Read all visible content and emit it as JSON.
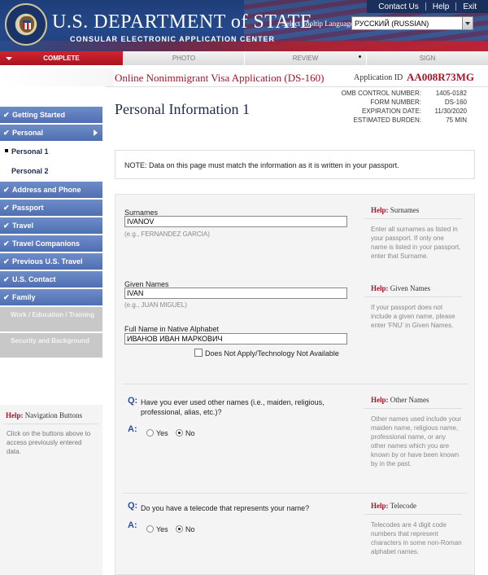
{
  "header": {
    "dept_title": "U.S. DEPARTMENT of STATE",
    "dept_subtitle": "CONSULAR ELECTRONIC APPLICATION CENTER",
    "top_links": [
      "Contact Us",
      "Help",
      "Exit"
    ],
    "tooltip_language_label": "Select Tooltip Language",
    "tooltip_language_value": "РУССКИЙ (RUSSIAN)"
  },
  "progress": {
    "steps": [
      "COMPLETE",
      "PHOTO",
      "REVIEW",
      "SIGN"
    ],
    "active_index": 0
  },
  "app": {
    "title": "Online Nonimmigrant Visa Application (DS-160)",
    "id_label": "Application ID",
    "id_value": "AA008R73MG"
  },
  "omb": [
    {
      "label": "OMB CONTROL NUMBER:",
      "value": "1405-0182"
    },
    {
      "label": "FORM NUMBER:",
      "value": "DS-160"
    },
    {
      "label": "EXPIRATION DATE:",
      "value": "11/30/2020"
    },
    {
      "label": "ESTIMATED BURDEN:",
      "value": "75 MIN"
    }
  ],
  "page_title": "Personal Information 1",
  "note": "NOTE: Data on this page must match the information as it is written in your passport.",
  "sidebar": {
    "items": [
      {
        "label": "Getting Started",
        "type": "nav"
      },
      {
        "label": "Personal",
        "type": "nav"
      },
      {
        "label": "Personal 1",
        "type": "sub"
      },
      {
        "label": "Personal 2",
        "type": "sub"
      },
      {
        "label": "Address and Phone",
        "type": "nav"
      },
      {
        "label": "Passport",
        "type": "nav"
      },
      {
        "label": "Travel",
        "type": "nav"
      },
      {
        "label": "Travel Companions",
        "type": "nav"
      },
      {
        "label": "Previous U.S. Travel",
        "type": "nav"
      },
      {
        "label": "U.S. Contact",
        "type": "nav"
      },
      {
        "label": "Family",
        "type": "nav"
      },
      {
        "label": "Work / Education / Training",
        "type": "disabled"
      },
      {
        "label": "Security and Background",
        "type": "disabled"
      }
    ],
    "check_glyph": "✔",
    "help": {
      "prefix": "Help:",
      "title": "Navigation Buttons",
      "text": "Click on the buttons above to access previously entered data."
    }
  },
  "form": {
    "surnames": {
      "label": "Surnames",
      "value": "IVANOV",
      "hint": "(e.g., FERNANDEZ GARCIA)"
    },
    "given_names": {
      "label": "Given Names",
      "value": "IVAN",
      "hint": "(e.g., JUAN MIGUEL)"
    },
    "native_name": {
      "label": "Full Name in Native Alphabet",
      "value": "ИВАНОВ ИВАН МАРКОВИЧ",
      "dna_label": "Does Not Apply/Technology Not Available"
    },
    "q_other_names": {
      "q": "Q:",
      "a": "A:",
      "text": "Have you ever used other names (i.e., maiden, religious, professional, alias, etc.)?",
      "yes": "Yes",
      "no": "No",
      "selected": "No"
    },
    "q_telecode": {
      "q": "Q:",
      "a": "A:",
      "text": "Do you have a telecode that represents your name?",
      "yes": "Yes",
      "no": "No",
      "selected": "No"
    }
  },
  "help_panels": {
    "prefix": "Help:",
    "surnames": {
      "title": "Surnames",
      "text": "Enter all surnames as listed in your passport. If only one name is listed in your passport, enter that Surname."
    },
    "given_names": {
      "title": "Given Names",
      "text": "If your passport does not include a given name, please enter 'FNU' in Given Names."
    },
    "other_names": {
      "title": "Other Names",
      "text": "Other names used include your maiden name, religious name, professional name, or any other names which you are known by or have been known by in the past."
    },
    "telecode": {
      "title": "Telecode",
      "text": "Telecodes are 4 digit code numbers that represent characters in some non-Roman alphabet names."
    }
  },
  "colors": {
    "accent_red": "#a3162a",
    "nav_blue": "#4f6fb2",
    "header_blue": "#1d3e78"
  }
}
